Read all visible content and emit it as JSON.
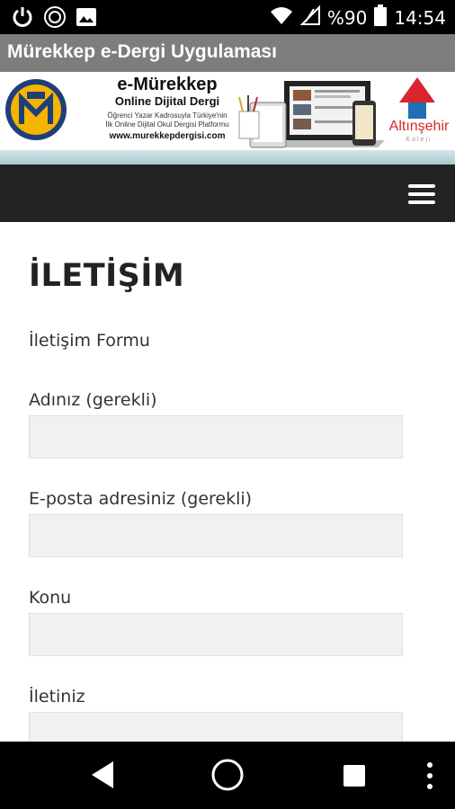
{
  "status_bar": {
    "battery_label": "%90",
    "time": "14:54",
    "icons": [
      "power-icon",
      "sync-icon",
      "image-icon",
      "wifi-icon",
      "signal-icon",
      "battery-icon"
    ]
  },
  "app": {
    "title": "Mürekkep e-Dergi Uygulaması"
  },
  "banner": {
    "brand_title": "e-Mürekkep",
    "brand_subtitle": "Online Dijital Dergi",
    "tagline_1": "Öğrenci Yazar Kadrosuyla Türkiye'nin",
    "tagline_2": "İlk Online Dijital Okul Dergisi Platformu",
    "website": "www.murekkepdergisi.com",
    "partner_name": "Altınşehir",
    "partner_sub": "Koleji"
  },
  "page": {
    "title": "İLETİŞİM",
    "form_title": "İletişim Formu",
    "fields": [
      {
        "label": "Adınız (gerekli)",
        "value": ""
      },
      {
        "label": "E-posta adresiniz (gerekli)",
        "value": ""
      },
      {
        "label": "Konu",
        "value": ""
      },
      {
        "label": "İletiniz",
        "value": ""
      }
    ]
  },
  "colors": {
    "navbar": "#232323",
    "titlebar": "#7d7d7d",
    "field_bg": "#f1f1f1",
    "partner_red": "#d9262e"
  }
}
